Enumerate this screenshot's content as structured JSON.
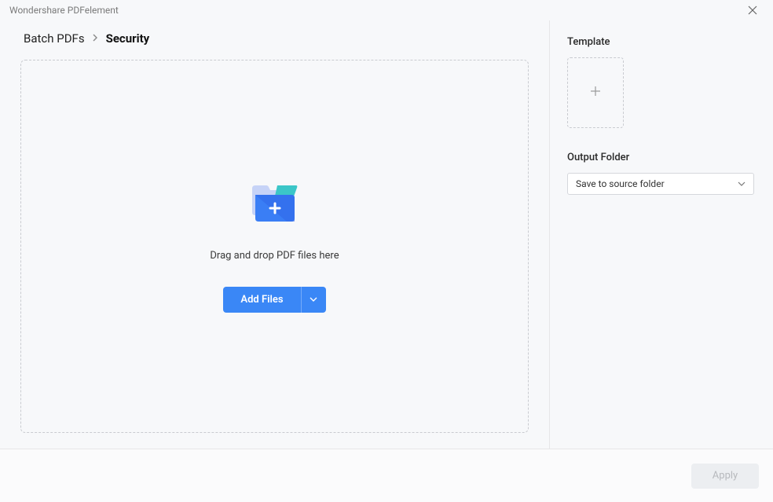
{
  "window": {
    "title": "Wondershare PDFelement"
  },
  "breadcrumb": {
    "parent": "Batch PDFs",
    "current": "Security"
  },
  "dropzone": {
    "text": "Drag and drop PDF files here",
    "add_files_label": "Add Files"
  },
  "sidebar": {
    "template_label": "Template",
    "output_folder_label": "Output Folder",
    "output_folder_value": "Save to source folder"
  },
  "footer": {
    "apply_label": "Apply"
  }
}
